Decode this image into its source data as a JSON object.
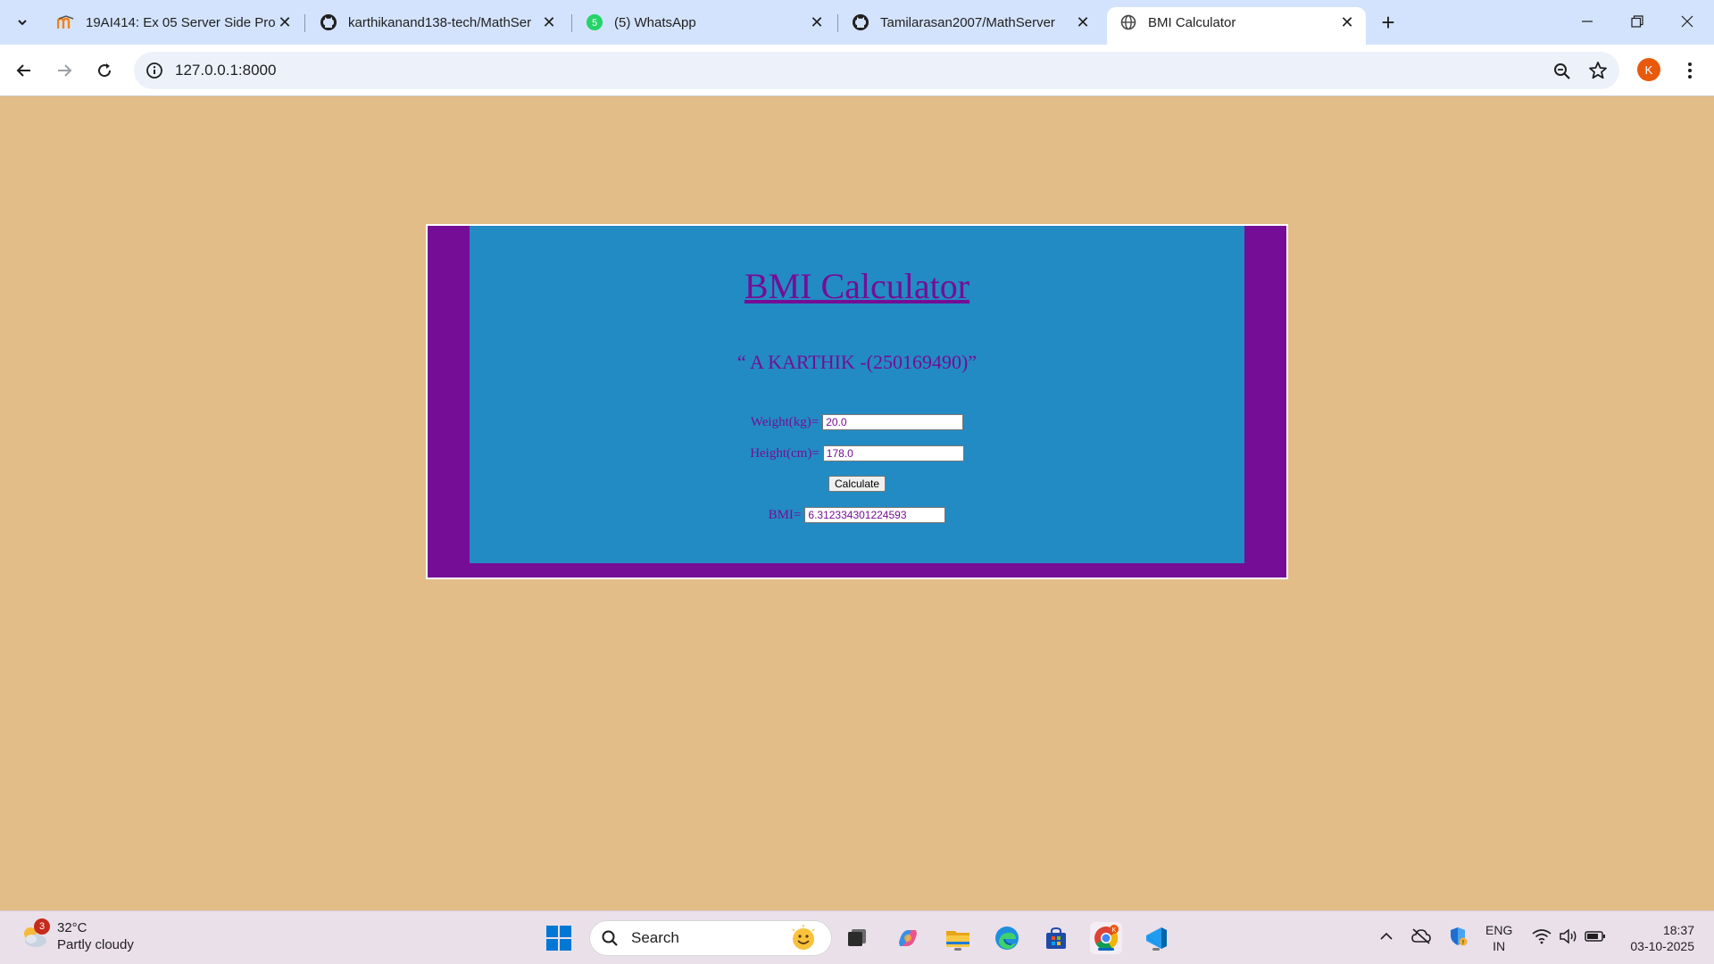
{
  "browser": {
    "tabs": [
      {
        "title": "19AI414: Ex 05 Server Side Proc",
        "icon": "moodle-icon"
      },
      {
        "title": "karthikanand138-tech/MathSer",
        "icon": "github-icon"
      },
      {
        "title": "(5) WhatsApp",
        "icon": "whatsapp-icon"
      },
      {
        "title": "Tamilarasan2007/MathServer",
        "icon": "github-icon"
      },
      {
        "title": "BMI Calculator",
        "icon": "globe-icon"
      }
    ],
    "url": "127.0.0.1:8000",
    "profile_initial": "K"
  },
  "page": {
    "title": "BMI Calculator",
    "author": "“ A KARTHIK -(250169490)”",
    "weight_label": "Weight(kg)=",
    "weight_value": "20.0",
    "height_label": "Height(cm)=",
    "height_value": "178.0",
    "calculate_label": "Calculate",
    "bmi_label": "BMI=",
    "bmi_value": "6.312334301224593"
  },
  "colors": {
    "page_bg": "#e3bd87",
    "frame": "#760d96",
    "panel": "#228bc4"
  },
  "taskbar": {
    "weather_badge": "3",
    "temperature": "32°C",
    "condition": "Partly cloudy",
    "search_placeholder": "Search",
    "lang_top": "ENG",
    "lang_bottom": "IN",
    "time": "18:37",
    "date": "03-10-2025"
  }
}
